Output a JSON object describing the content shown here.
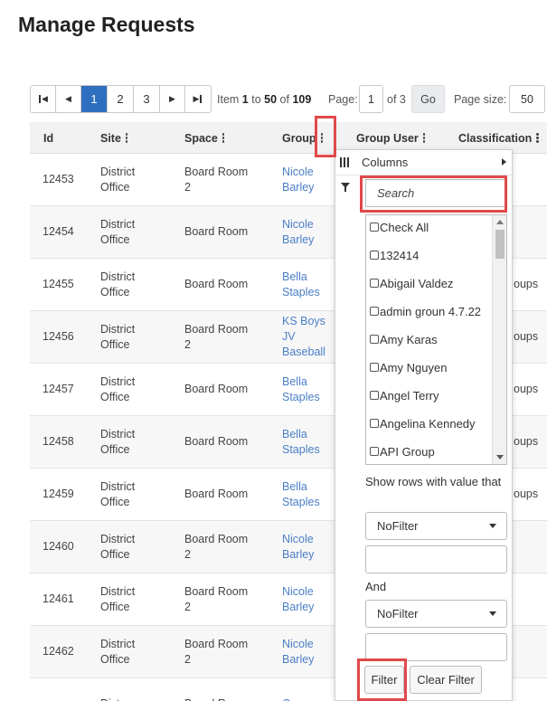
{
  "page": {
    "title": "Manage Requests"
  },
  "pager": {
    "pages": [
      "1",
      "2",
      "3"
    ],
    "active_page": "1",
    "item_prefix": "Item",
    "item_from": "1",
    "item_to_word": "to",
    "item_to": "50",
    "item_of_word": "of",
    "item_total": "109",
    "page_label": "Page:",
    "page_value": "1",
    "page_of": "of 3",
    "go_label": "Go",
    "page_size_label": "Page size:",
    "page_size_value": "50"
  },
  "grid": {
    "columns": {
      "id": "Id",
      "site": "Site",
      "space": "Space",
      "group": "Group",
      "group_user": "Group User",
      "classification": "Classification"
    },
    "rows": [
      {
        "id": "12453",
        "site": [
          "District",
          "Office"
        ],
        "space": [
          "Board Room",
          "2"
        ],
        "group": [
          "Nicole",
          "Barley"
        ],
        "classification": ""
      },
      {
        "id": "12454",
        "site": [
          "District",
          "Office"
        ],
        "space": [
          "Board Room"
        ],
        "group": [
          "Nicole",
          "Barley"
        ],
        "classification": ""
      },
      {
        "id": "12455",
        "site": [
          "District",
          "Office"
        ],
        "space": [
          "Board Room"
        ],
        "group": [
          "Bella",
          "Staples"
        ],
        "classification": "oups"
      },
      {
        "id": "12456",
        "site": [
          "District",
          "Office"
        ],
        "space": [
          "Board Room",
          "2"
        ],
        "group": [
          "KS Boys",
          "JV",
          "Baseball"
        ],
        "classification": "oups"
      },
      {
        "id": "12457",
        "site": [
          "District",
          "Office"
        ],
        "space": [
          "Board Room"
        ],
        "group": [
          "Bella",
          "Staples"
        ],
        "classification": "oups"
      },
      {
        "id": "12458",
        "site": [
          "District",
          "Office"
        ],
        "space": [
          "Board Room"
        ],
        "group": [
          "Bella",
          "Staples"
        ],
        "classification": "oups"
      },
      {
        "id": "12459",
        "site": [
          "District",
          "Office"
        ],
        "space": [
          "Board Room"
        ],
        "group": [
          "Bella",
          "Staples"
        ],
        "classification": "oups"
      },
      {
        "id": "12460",
        "site": [
          "District",
          "Office"
        ],
        "space": [
          "Board Room",
          "2"
        ],
        "group": [
          "Nicole",
          "Barley"
        ],
        "classification": ""
      },
      {
        "id": "12461",
        "site": [
          "District",
          "Office"
        ],
        "space": [
          "Board Room",
          "2"
        ],
        "group": [
          "Nicole",
          "Barley"
        ],
        "classification": ""
      },
      {
        "id": "12462",
        "site": [
          "District",
          "Office"
        ],
        "space": [
          "Board Room",
          "2"
        ],
        "group": [
          "Nicole",
          "Barley"
        ],
        "classification": ""
      },
      {
        "id": "",
        "site": [
          "Distr"
        ],
        "space": [
          "Board R"
        ],
        "group": [
          "C"
        ],
        "classification": ""
      }
    ]
  },
  "column_menu": {
    "columns_label": "Columns",
    "search_placeholder": "Search",
    "filter_items": [
      "Check All",
      "132414",
      "Abigail Valdez",
      "admin groun 4.7.22",
      "Amy Karas",
      "Amy Nguyen",
      "Angel Terry",
      "Angelina Kennedy",
      "API Group"
    ],
    "show_rows_label": "Show rows with value that",
    "condition1": "NoFilter",
    "and_label": "And",
    "condition2": "NoFilter",
    "filter_button": "Filter",
    "clear_button": "Clear Filter"
  },
  "colors": {
    "accent": "#2f6fbf",
    "link": "#4a7ec6",
    "highlight": "#e0494b"
  }
}
